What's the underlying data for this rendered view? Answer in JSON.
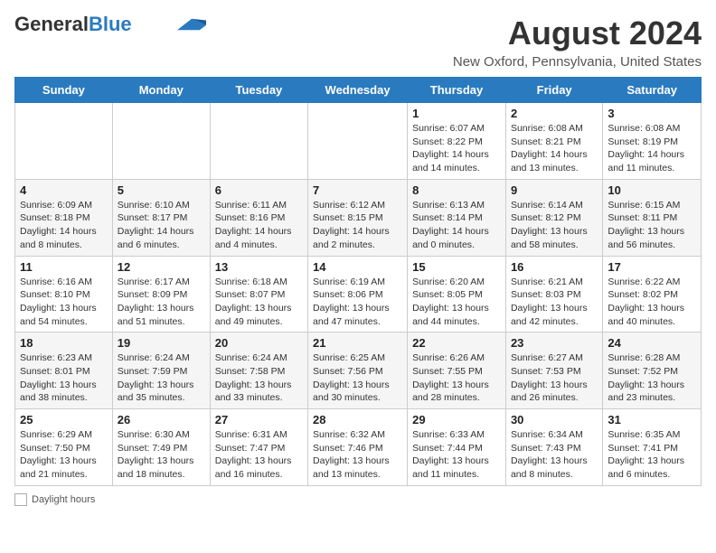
{
  "header": {
    "logo_general": "General",
    "logo_blue": "Blue",
    "month_title": "August 2024",
    "location": "New Oxford, Pennsylvania, United States"
  },
  "days_of_week": [
    "Sunday",
    "Monday",
    "Tuesday",
    "Wednesday",
    "Thursday",
    "Friday",
    "Saturday"
  ],
  "weeks": [
    [
      {
        "day": "",
        "info": ""
      },
      {
        "day": "",
        "info": ""
      },
      {
        "day": "",
        "info": ""
      },
      {
        "day": "",
        "info": ""
      },
      {
        "day": "1",
        "info": "Sunrise: 6:07 AM\nSunset: 8:22 PM\nDaylight: 14 hours and 14 minutes."
      },
      {
        "day": "2",
        "info": "Sunrise: 6:08 AM\nSunset: 8:21 PM\nDaylight: 14 hours and 13 minutes."
      },
      {
        "day": "3",
        "info": "Sunrise: 6:08 AM\nSunset: 8:19 PM\nDaylight: 14 hours and 11 minutes."
      }
    ],
    [
      {
        "day": "4",
        "info": "Sunrise: 6:09 AM\nSunset: 8:18 PM\nDaylight: 14 hours and 8 minutes."
      },
      {
        "day": "5",
        "info": "Sunrise: 6:10 AM\nSunset: 8:17 PM\nDaylight: 14 hours and 6 minutes."
      },
      {
        "day": "6",
        "info": "Sunrise: 6:11 AM\nSunset: 8:16 PM\nDaylight: 14 hours and 4 minutes."
      },
      {
        "day": "7",
        "info": "Sunrise: 6:12 AM\nSunset: 8:15 PM\nDaylight: 14 hours and 2 minutes."
      },
      {
        "day": "8",
        "info": "Sunrise: 6:13 AM\nSunset: 8:14 PM\nDaylight: 14 hours and 0 minutes."
      },
      {
        "day": "9",
        "info": "Sunrise: 6:14 AM\nSunset: 8:12 PM\nDaylight: 13 hours and 58 minutes."
      },
      {
        "day": "10",
        "info": "Sunrise: 6:15 AM\nSunset: 8:11 PM\nDaylight: 13 hours and 56 minutes."
      }
    ],
    [
      {
        "day": "11",
        "info": "Sunrise: 6:16 AM\nSunset: 8:10 PM\nDaylight: 13 hours and 54 minutes."
      },
      {
        "day": "12",
        "info": "Sunrise: 6:17 AM\nSunset: 8:09 PM\nDaylight: 13 hours and 51 minutes."
      },
      {
        "day": "13",
        "info": "Sunrise: 6:18 AM\nSunset: 8:07 PM\nDaylight: 13 hours and 49 minutes."
      },
      {
        "day": "14",
        "info": "Sunrise: 6:19 AM\nSunset: 8:06 PM\nDaylight: 13 hours and 47 minutes."
      },
      {
        "day": "15",
        "info": "Sunrise: 6:20 AM\nSunset: 8:05 PM\nDaylight: 13 hours and 44 minutes."
      },
      {
        "day": "16",
        "info": "Sunrise: 6:21 AM\nSunset: 8:03 PM\nDaylight: 13 hours and 42 minutes."
      },
      {
        "day": "17",
        "info": "Sunrise: 6:22 AM\nSunset: 8:02 PM\nDaylight: 13 hours and 40 minutes."
      }
    ],
    [
      {
        "day": "18",
        "info": "Sunrise: 6:23 AM\nSunset: 8:01 PM\nDaylight: 13 hours and 38 minutes."
      },
      {
        "day": "19",
        "info": "Sunrise: 6:24 AM\nSunset: 7:59 PM\nDaylight: 13 hours and 35 minutes."
      },
      {
        "day": "20",
        "info": "Sunrise: 6:24 AM\nSunset: 7:58 PM\nDaylight: 13 hours and 33 minutes."
      },
      {
        "day": "21",
        "info": "Sunrise: 6:25 AM\nSunset: 7:56 PM\nDaylight: 13 hours and 30 minutes."
      },
      {
        "day": "22",
        "info": "Sunrise: 6:26 AM\nSunset: 7:55 PM\nDaylight: 13 hours and 28 minutes."
      },
      {
        "day": "23",
        "info": "Sunrise: 6:27 AM\nSunset: 7:53 PM\nDaylight: 13 hours and 26 minutes."
      },
      {
        "day": "24",
        "info": "Sunrise: 6:28 AM\nSunset: 7:52 PM\nDaylight: 13 hours and 23 minutes."
      }
    ],
    [
      {
        "day": "25",
        "info": "Sunrise: 6:29 AM\nSunset: 7:50 PM\nDaylight: 13 hours and 21 minutes."
      },
      {
        "day": "26",
        "info": "Sunrise: 6:30 AM\nSunset: 7:49 PM\nDaylight: 13 hours and 18 minutes."
      },
      {
        "day": "27",
        "info": "Sunrise: 6:31 AM\nSunset: 7:47 PM\nDaylight: 13 hours and 16 minutes."
      },
      {
        "day": "28",
        "info": "Sunrise: 6:32 AM\nSunset: 7:46 PM\nDaylight: 13 hours and 13 minutes."
      },
      {
        "day": "29",
        "info": "Sunrise: 6:33 AM\nSunset: 7:44 PM\nDaylight: 13 hours and 11 minutes."
      },
      {
        "day": "30",
        "info": "Sunrise: 6:34 AM\nSunset: 7:43 PM\nDaylight: 13 hours and 8 minutes."
      },
      {
        "day": "31",
        "info": "Sunrise: 6:35 AM\nSunset: 7:41 PM\nDaylight: 13 hours and 6 minutes."
      }
    ]
  ],
  "footer": {
    "daylight_label": "Daylight hours"
  }
}
